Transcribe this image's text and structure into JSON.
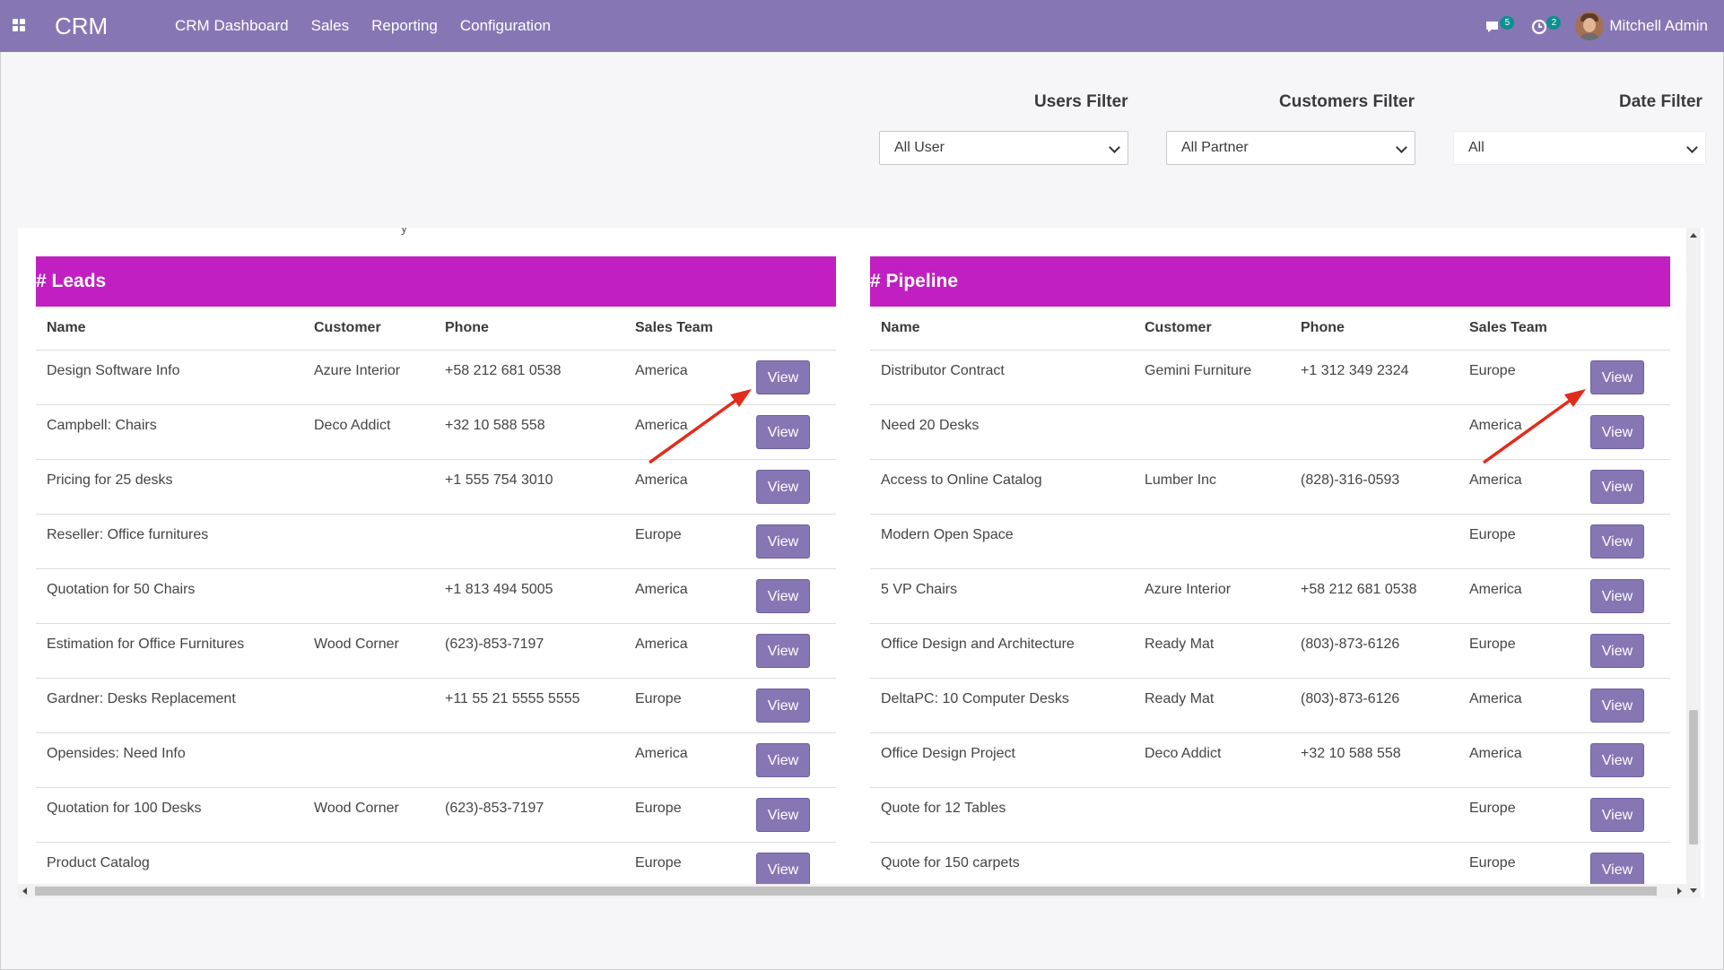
{
  "nav": {
    "brand": "CRM",
    "menu": [
      "CRM Dashboard",
      "Sales",
      "Reporting",
      "Configuration"
    ],
    "messages_count": "5",
    "activities_count": "2",
    "user_name": "Mitchell Admin"
  },
  "filters": {
    "users": {
      "label": "Users Filter",
      "value": "All User"
    },
    "customers": {
      "label": "Customers Filter",
      "value": "All Partner"
    },
    "date": {
      "label": "Date Filter",
      "value": "All"
    }
  },
  "leads": {
    "title": "# Leads",
    "columns": [
      "Name",
      "Customer",
      "Phone",
      "Sales Team"
    ],
    "button_label": "View",
    "rows": [
      {
        "name": "Design Software Info",
        "customer": "Azure Interior",
        "phone": "+58 212 681 0538",
        "team": "America"
      },
      {
        "name": "Campbell: Chairs",
        "customer": "Deco Addict",
        "phone": "+32 10 588 558",
        "team": "America"
      },
      {
        "name": "Pricing for 25 desks",
        "customer": "",
        "phone": "+1 555 754 3010",
        "team": "America"
      },
      {
        "name": "Reseller: Office furnitures",
        "customer": "",
        "phone": "",
        "team": "Europe"
      },
      {
        "name": "Quotation for 50 Chairs",
        "customer": "",
        "phone": "+1 813 494 5005",
        "team": "America"
      },
      {
        "name": "Estimation for Office Furnitures",
        "customer": "Wood Corner",
        "phone": "(623)-853-7197",
        "team": "America"
      },
      {
        "name": "Gardner: Desks Replacement",
        "customer": "",
        "phone": "+11 55 21 5555 5555",
        "team": "Europe"
      },
      {
        "name": "Opensides: Need Info",
        "customer": "",
        "phone": "",
        "team": "America"
      },
      {
        "name": "Quotation for 100 Desks",
        "customer": "Wood Corner",
        "phone": "(623)-853-7197",
        "team": "Europe"
      },
      {
        "name": "Product Catalog",
        "customer": "",
        "phone": "",
        "team": "Europe"
      }
    ]
  },
  "pipeline": {
    "title": "# Pipeline",
    "columns": [
      "Name",
      "Customer",
      "Phone",
      "Sales Team"
    ],
    "button_label": "View",
    "rows": [
      {
        "name": "Distributor Contract",
        "customer": "Gemini Furniture",
        "phone": "+1 312 349 2324",
        "team": "Europe"
      },
      {
        "name": "Need 20 Desks",
        "customer": "",
        "phone": "",
        "team": "America"
      },
      {
        "name": "Access to Online Catalog",
        "customer": "Lumber Inc",
        "phone": "(828)-316-0593",
        "team": "America"
      },
      {
        "name": "Modern Open Space",
        "customer": "",
        "phone": "",
        "team": "Europe"
      },
      {
        "name": "5 VP Chairs",
        "customer": "Azure Interior",
        "phone": "+58 212 681 0538",
        "team": "America"
      },
      {
        "name": "Office Design and Architecture",
        "customer": "Ready Mat",
        "phone": "(803)-873-6126",
        "team": "Europe"
      },
      {
        "name": "DeltaPC: 10 Computer Desks",
        "customer": "Ready Mat",
        "phone": "(803)-873-6126",
        "team": "America"
      },
      {
        "name": "Office Design Project",
        "customer": "Deco Addict",
        "phone": "+32 10 588 558",
        "team": "America"
      },
      {
        "name": "Quote for 12 Tables",
        "customer": "",
        "phone": "",
        "team": "Europe"
      },
      {
        "name": "Quote for 150 carpets",
        "customer": "",
        "phone": "",
        "team": "Europe"
      }
    ]
  },
  "colors": {
    "navbar": "#8677b4",
    "card_header": "#c11fc2",
    "view_button": "#8677b4",
    "annotation_arrow": "#e32b1c"
  }
}
